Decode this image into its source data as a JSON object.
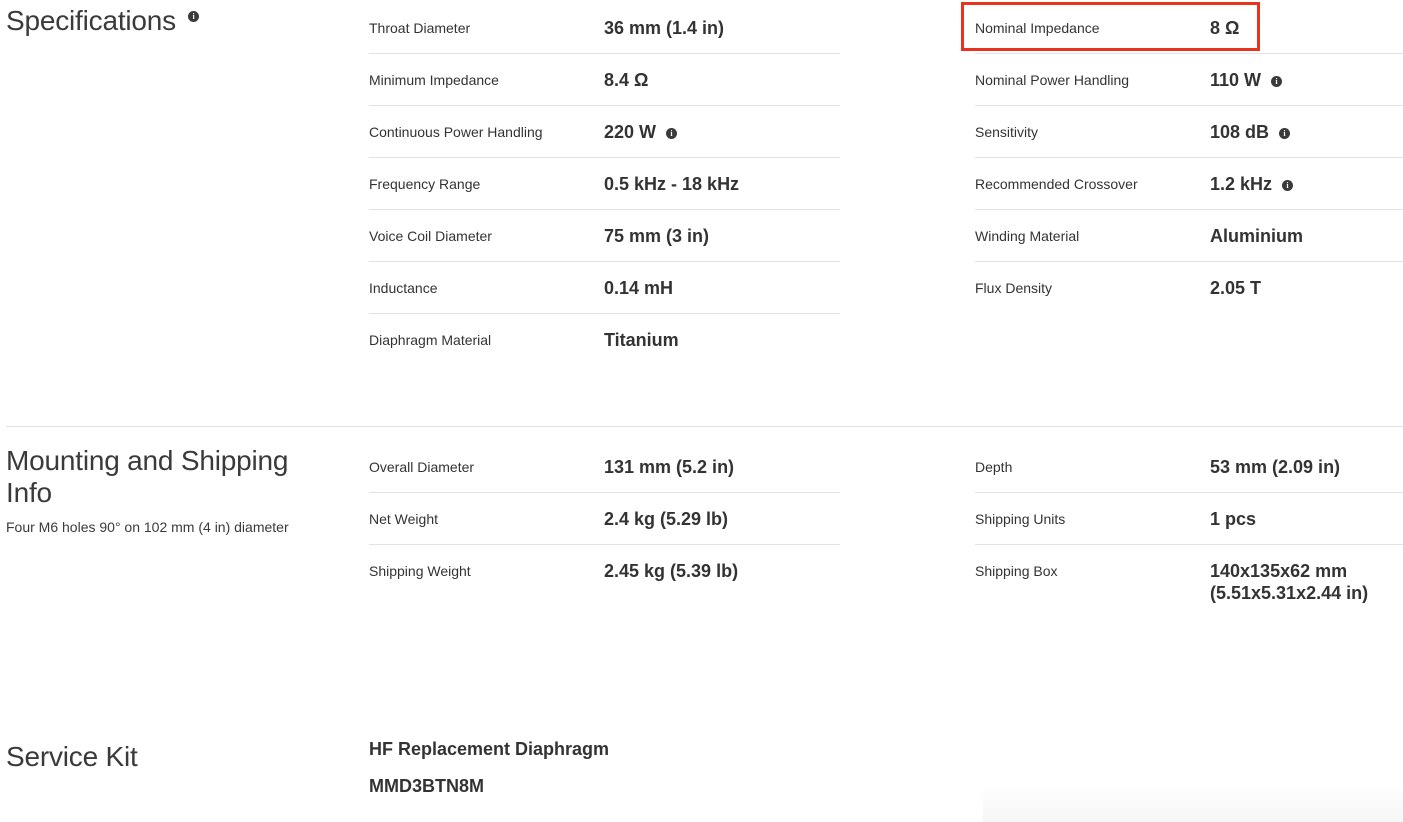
{
  "specifications": {
    "title": "Specifications",
    "left_rows": [
      {
        "label": "Throat Diameter",
        "value": "36 mm (1.4 in)",
        "info": false
      },
      {
        "label": "Minimum Impedance",
        "value": "8.4 Ω",
        "info": false
      },
      {
        "label": "Continuous Power Handling",
        "value": "220 W",
        "info": true
      },
      {
        "label": "Frequency Range",
        "value": "0.5 kHz - 18 kHz",
        "info": false
      },
      {
        "label": "Voice Coil Diameter",
        "value": "75 mm (3 in)",
        "info": false
      },
      {
        "label": "Inductance",
        "value": "0.14 mH",
        "info": false
      },
      {
        "label": "Diaphragm Material",
        "value": "Titanium",
        "info": false
      }
    ],
    "right_rows": [
      {
        "label": "Nominal Impedance",
        "value": "8 Ω",
        "info": false
      },
      {
        "label": "Nominal Power Handling",
        "value": "110 W",
        "info": true
      },
      {
        "label": "Sensitivity",
        "value": "108 dB",
        "info": true
      },
      {
        "label": "Recommended Crossover",
        "value": "1.2 kHz",
        "info": true
      },
      {
        "label": "Winding Material",
        "value": "Aluminium",
        "info": false
      },
      {
        "label": "Flux Density",
        "value": "2.05 T",
        "info": false
      }
    ]
  },
  "mounting": {
    "title_line1": "Mounting and Shipping",
    "title_line2": "Info",
    "note": "Four M6 holes 90° on 102 mm (4 in) diameter",
    "left_rows": [
      {
        "label": "Overall Diameter",
        "value": "131 mm (5.2 in)"
      },
      {
        "label": "Net Weight",
        "value": "2.4 kg (5.29 lb)"
      },
      {
        "label": "Shipping Weight",
        "value": "2.45 kg (5.39 lb)"
      }
    ],
    "right_rows": [
      {
        "label": "Depth",
        "value": "53 mm (2.09 in)"
      },
      {
        "label": "Shipping Units",
        "value": "1 pcs"
      },
      {
        "label": "Shipping Box",
        "value_line1": "140x135x62 mm",
        "value_line2": "(5.51x5.31x2.44 in)"
      }
    ]
  },
  "service_kit": {
    "title": "Service Kit",
    "item_name": "HF Replacement Diaphragm",
    "item_code": "MMD3BTN8M"
  },
  "icons": {
    "info": "info-icon"
  },
  "colors": {
    "highlight": "#e8331e",
    "text": "#333333",
    "divider": "#e3e3e3"
  }
}
